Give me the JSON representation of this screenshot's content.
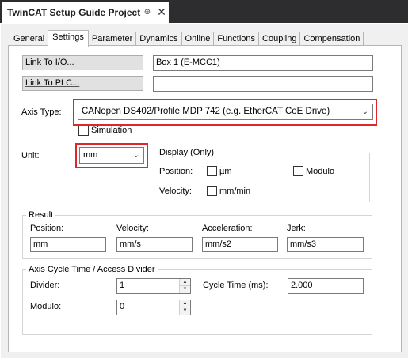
{
  "document_tab": {
    "title": "TwinCAT Setup Guide Project",
    "pin_glyph": "⊕",
    "close_glyph": "✕"
  },
  "tabs": [
    {
      "label": "General"
    },
    {
      "label": "Settings",
      "active": true
    },
    {
      "label": "Parameter"
    },
    {
      "label": "Dynamics"
    },
    {
      "label": "Online"
    },
    {
      "label": "Functions"
    },
    {
      "label": "Coupling"
    },
    {
      "label": "Compensation"
    }
  ],
  "link": {
    "io_button": "Link To I/O...",
    "io_value": "Box 1 (E-MCC1)",
    "plc_button": "Link To PLC...",
    "plc_value": ""
  },
  "axis_type": {
    "label": "Axis Type:",
    "value": "CANopen DS402/Profile MDP 742 (e.g. EtherCAT CoE Drive)",
    "simulation_label": "Simulation",
    "simulation_checked": false
  },
  "unit": {
    "label": "Unit:",
    "value": "mm"
  },
  "display": {
    "title": "Display (Only)",
    "position_label": "Position:",
    "um_label": "µm",
    "um_checked": false,
    "modulo_label": "Modulo",
    "modulo_checked": false,
    "velocity_label": "Velocity:",
    "mmmin_label": "mm/min",
    "mmmin_checked": false
  },
  "result": {
    "title": "Result",
    "position_label": "Position:",
    "position_value": "mm",
    "velocity_label": "Velocity:",
    "velocity_value": "mm/s",
    "acceleration_label": "Acceleration:",
    "acceleration_value": "mm/s2",
    "jerk_label": "Jerk:",
    "jerk_value": "mm/s3"
  },
  "cycle": {
    "title": "Axis Cycle Time / Access Divider",
    "divider_label": "Divider:",
    "divider_value": "1",
    "cycle_time_label": "Cycle Time (ms):",
    "cycle_time_value": "2.000",
    "modulo_label": "Modulo:",
    "modulo_value": "0"
  },
  "colors": {
    "highlight": "#e0262b",
    "ide_dark": "#2d2d30"
  },
  "icons": {
    "chevron": "chevron-down-icon",
    "spin_up": "spin-up-icon",
    "spin_down": "spin-down-icon"
  }
}
